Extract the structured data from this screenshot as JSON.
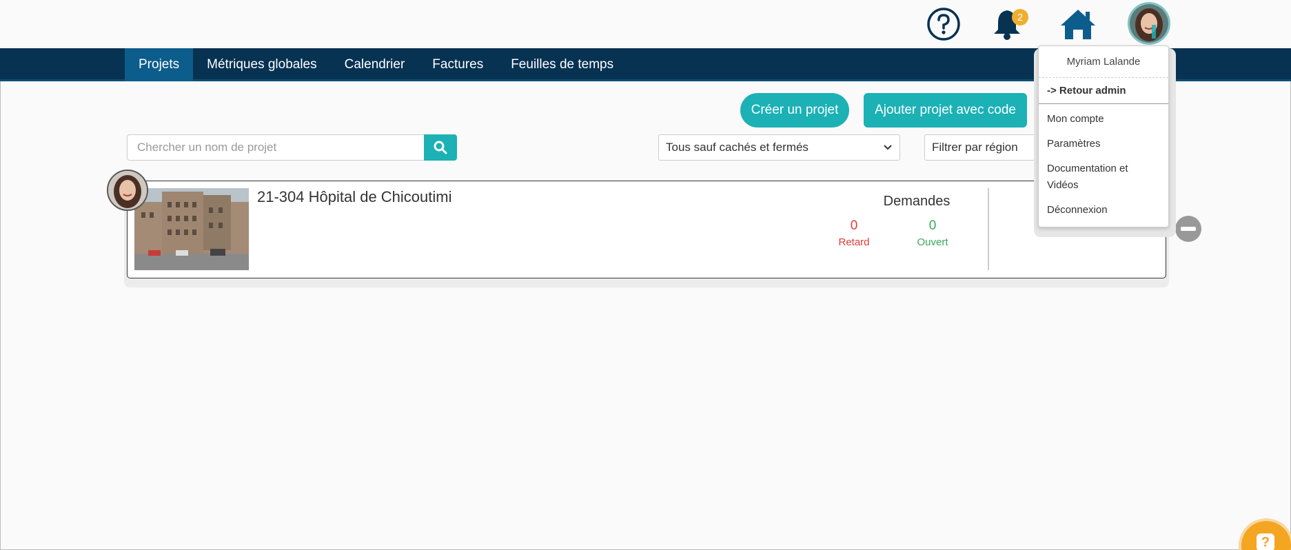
{
  "header": {
    "notifications_count": "2"
  },
  "nav": {
    "items": [
      {
        "label": "Projets",
        "active": true
      },
      {
        "label": "Métriques globales"
      },
      {
        "label": "Calendrier"
      },
      {
        "label": "Factures"
      },
      {
        "label": "Feuilles de temps"
      }
    ]
  },
  "actions": {
    "create_label": "Créer un projet",
    "add_code_label": "Ajouter projet avec code"
  },
  "search": {
    "placeholder": "Chercher un nom de projet"
  },
  "filters": {
    "status_value": "Tous sauf cachés et fermés",
    "region_value": "Filtrer par région"
  },
  "project": {
    "title": "21-304 Hôpital de Chicoutimi",
    "demandes_label": "Demandes",
    "retard_count": "0",
    "retard_label": "Retard",
    "ouvert_count": "0",
    "ouvert_label": "Ouvert"
  },
  "user_menu": {
    "user_name": "Myriam Lalande",
    "admin_return": "-> Retour admin",
    "items": [
      "Mon compte",
      "Paramètres",
      "Documentation et Vidéos",
      "Déconnexion"
    ]
  },
  "colors": {
    "navy": "#073252",
    "teal": "#1bb1b5",
    "retard": "#e03b3b",
    "ouvert": "#3aa85a",
    "badge": "#f0ad2e"
  }
}
